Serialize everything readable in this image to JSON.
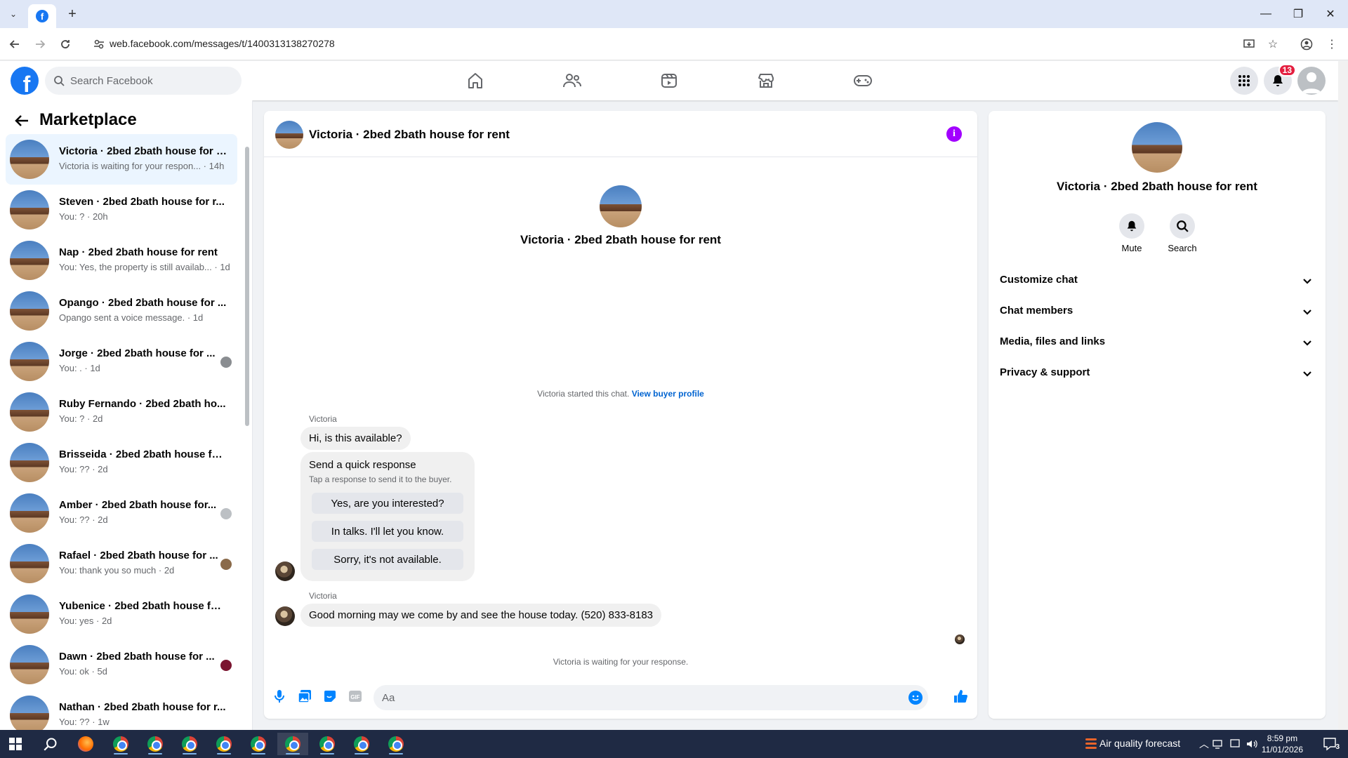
{
  "browser": {
    "url": "web.facebook.com/messages/t/1400313138270278",
    "new_tab": "+",
    "win_minimize": "—",
    "win_restore": "❐",
    "win_close": "✕"
  },
  "header": {
    "search_placeholder": "Search Facebook",
    "notifications_count": "13"
  },
  "sidebar": {
    "title": "Marketplace",
    "conversations": [
      {
        "name": "Victoria · 2bed 2bath house for r...",
        "snippet": "Victoria is waiting for your respon... · 14h"
      },
      {
        "name": "Steven · 2bed 2bath house for r...",
        "snippet": "You: ? · 20h"
      },
      {
        "name": "Nap · 2bed 2bath house for rent",
        "snippet": "You: Yes, the property is still availab... · 1d"
      },
      {
        "name": "Opango · 2bed 2bath house for ...",
        "snippet": "Opango sent a voice message. · 1d"
      },
      {
        "name": "Jorge · 2bed 2bath house for ...",
        "snippet": "You: . · 1d"
      },
      {
        "name": "Ruby Fernando · 2bed 2bath ho...",
        "snippet": "You: ? · 2d"
      },
      {
        "name": "Brisseida · 2bed 2bath house for...",
        "snippet": "You: ?? · 2d"
      },
      {
        "name": "Amber · 2bed 2bath house for...",
        "snippet": "You: ?? · 2d"
      },
      {
        "name": "Rafael · 2bed 2bath house for ...",
        "snippet": "You: thank you so much · 2d"
      },
      {
        "name": "Yubenice · 2bed 2bath house for...",
        "snippet": "You: yes · 2d"
      },
      {
        "name": "Dawn · 2bed 2bath house for ...",
        "snippet": "You: ok · 5d"
      },
      {
        "name": "Nathan · 2bed 2bath house for r...",
        "snippet": "You: ?? · 1w"
      }
    ]
  },
  "chat": {
    "title": "Victoria · 2bed 2bath house for rent",
    "intro_title": "Victoria · 2bed 2bath house for rent",
    "started_text": "Victoria started this chat.",
    "view_buyer_profile": "View buyer profile",
    "sender1": "Victoria",
    "message1": "Hi, is this available?",
    "quick_response_title": "Send a quick response",
    "quick_response_sub": "Tap a response to send it to the buyer.",
    "quick_responses": [
      "Yes, are you interested?",
      "In talks. I'll let you know.",
      "Sorry, it's not available."
    ],
    "sender2": "Victoria",
    "message2": "Good morning may we come by and see the house today. (520) 833-8183",
    "waiting_text": "Victoria is waiting for your response.",
    "composer_placeholder": "Aa"
  },
  "right_panel": {
    "title": "Victoria · 2bed 2bath house for rent",
    "mute_label": "Mute",
    "search_label": "Search",
    "sections": [
      "Customize chat",
      "Chat members",
      "Media, files and links",
      "Privacy & support"
    ]
  },
  "taskbar": {
    "weather": "Air quality forecast",
    "time": "8:59 pm",
    "date": "11/01/2026",
    "notification_count": "3"
  },
  "colors": {
    "facebook_blue": "#1877f2",
    "info_purple": "#a200ff",
    "active_row": "#ebf5ff"
  }
}
